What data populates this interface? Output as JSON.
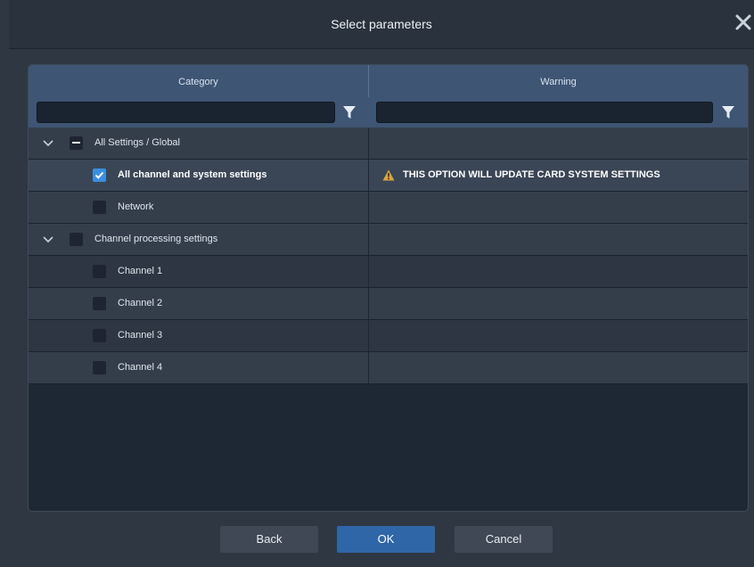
{
  "dialog": {
    "title": "Select parameters"
  },
  "columns": {
    "category": "Category",
    "warning": "Warning"
  },
  "filters": {
    "category_value": "",
    "warning_value": ""
  },
  "rows": [
    {
      "label": "All Settings / Global",
      "checkbox": "partial",
      "expanded": true,
      "warning": ""
    },
    {
      "label": "All channel and system settings",
      "checkbox": "checked",
      "warning": "THIS OPTION WILL UPDATE CARD SYSTEM SETTINGS"
    },
    {
      "label": "Network",
      "checkbox": "unchecked",
      "warning": ""
    },
    {
      "label": "Channel processing settings",
      "checkbox": "unchecked",
      "expanded": true,
      "warning": ""
    },
    {
      "label": "Channel 1",
      "checkbox": "unchecked",
      "warning": ""
    },
    {
      "label": "Channel 2",
      "checkbox": "unchecked",
      "warning": ""
    },
    {
      "label": "Channel 3",
      "checkbox": "unchecked",
      "warning": ""
    },
    {
      "label": "Channel 4",
      "checkbox": "unchecked",
      "warning": ""
    }
  ],
  "buttons": {
    "back": "Back",
    "ok": "OK",
    "cancel": "Cancel"
  },
  "colors": {
    "accent": "#2f66a8",
    "checkbox_checked": "#3a8fe0",
    "warning_icon": "#d9a441",
    "header": "#3e5573"
  },
  "icons": {
    "close": "close-icon",
    "filter": "filter-icon",
    "expander": "chevron-down-icon",
    "warning": "warning-triangle-icon"
  }
}
